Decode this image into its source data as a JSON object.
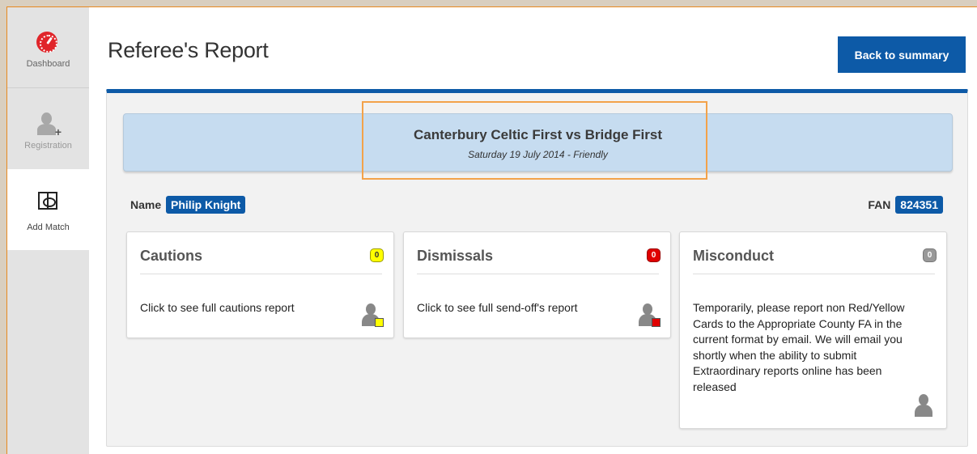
{
  "sidebar": {
    "items": [
      {
        "label": "Dashboard",
        "icon": "dashboard-gauge-icon"
      },
      {
        "label": "Registration",
        "icon": "add-person-icon"
      },
      {
        "label": "Add Match",
        "icon": "pitch-icon"
      }
    ]
  },
  "header": {
    "title": "Referee's Report",
    "back_label": "Back to summary"
  },
  "match": {
    "title": "Canterbury Celtic First vs Bridge First",
    "subtitle": "Saturday 19 July 2014 - Friendly"
  },
  "referee": {
    "name_label": "Name",
    "name": "Philip Knight",
    "fan_label": "FAN",
    "fan": "824351"
  },
  "cards": [
    {
      "title": "Cautions",
      "count": "0",
      "text": "Click to see full cautions report",
      "badge_color": "#ffff00"
    },
    {
      "title": "Dismissals",
      "count": "0",
      "text": "Click to see full send-off's report",
      "badge_color": "#e00000"
    },
    {
      "title": "Misconduct",
      "count": "0",
      "text": "Temporarily, please report non Red/Yellow Cards to the Appropriate County FA in the current format by email. We will email you shortly when the ability to submit Extraordinary reports online has been released",
      "badge_color": "#999999"
    }
  ],
  "colors": {
    "brand_blue": "#0d5aa7",
    "banner_blue": "#c6dcf0",
    "highlight_orange": "#f3a24a"
  }
}
